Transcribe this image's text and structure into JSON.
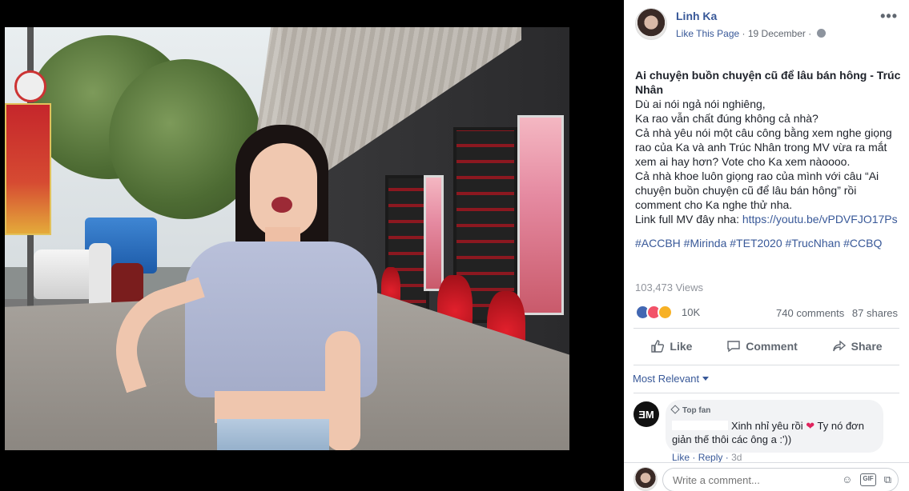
{
  "post": {
    "page_name": "Linh Ka",
    "like_page": "Like This Page",
    "date": "19 December",
    "more": "•••",
    "title_line": "Ai chuyện buồn chuyện cũ để lâu bán hông - Trúc Nhân",
    "lines": [
      "Dù ai nói ngả nói nghiêng,",
      "Ka rao vẫn chất đúng không cả nhà?",
      "Cả nhà yêu nói một câu công bằng xem nghe giọng rao của Ka và anh Trúc Nhân trong MV vừa ra mắt xem ai hay hơn? Vote cho Ka xem nàoooo.",
      "Cả nhà khoe luôn giọng rao của mình với câu “Ai chuyện buồn chuyện cũ để lâu bán hông” rồi comment cho Ka nghe thử nha."
    ],
    "link_prefix": "Link full MV đây nha: ",
    "link_url": "https://youtu.be/vPDVFJO17Ps",
    "hashtags": "#ACCBH #Mirinda #TET2020 #TrucNhan #CCBQ",
    "views": "103,473 Views",
    "reaction_count": "10K",
    "comments": "740 comments",
    "shares": "87 shares"
  },
  "actions": {
    "like": "Like",
    "comment": "Comment",
    "share": "Share"
  },
  "sort_label": "Most Relevant",
  "comment": {
    "avatar_text": "ƎM",
    "badge": "Top fan",
    "text_before": "Xinh nhỉ yêu rồi",
    "heart": "❤",
    "text_after": "Ty nó đơn giản thế thôi các ông a :'))",
    "like": "Like",
    "reply": "Reply",
    "time": "3d"
  },
  "composer": {
    "placeholder": "Write a comment...",
    "emoji": "☺",
    "gif": "GIF",
    "sticker": "⧉"
  }
}
